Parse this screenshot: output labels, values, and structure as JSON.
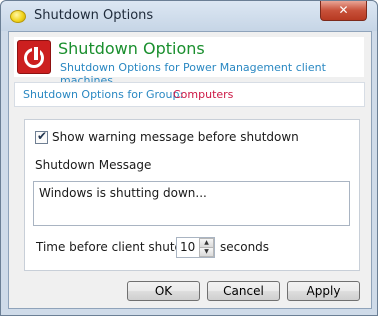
{
  "window": {
    "title": "Shutdown Options",
    "close_label": "✕"
  },
  "header": {
    "title": "Shutdown Options",
    "subtitle": "Shutdown Options for Power Management client machines"
  },
  "group": {
    "label": "Shutdown Options for Group:",
    "value": "Computers"
  },
  "settings": {
    "show_warning_checked": true,
    "show_warning_label": "Show warning message before shutdown",
    "message_label": "Shutdown Message",
    "message_value": "Windows is shutting down...",
    "time_label": "Time before client shutdown",
    "time_value": "10",
    "time_unit": "seconds"
  },
  "buttons": {
    "ok": "OK",
    "cancel": "Cancel",
    "apply": "Apply"
  },
  "icons": {
    "title_icon": "yellow-orb-icon",
    "header_icon": "power-icon",
    "spin_up": "▲",
    "spin_down": "▼",
    "check_mark": "✔"
  },
  "colors": {
    "header_title": "#1a8f2e",
    "header_subtitle": "#2a88c2",
    "group_label": "#2a88c2",
    "group_value": "#cc1744"
  }
}
